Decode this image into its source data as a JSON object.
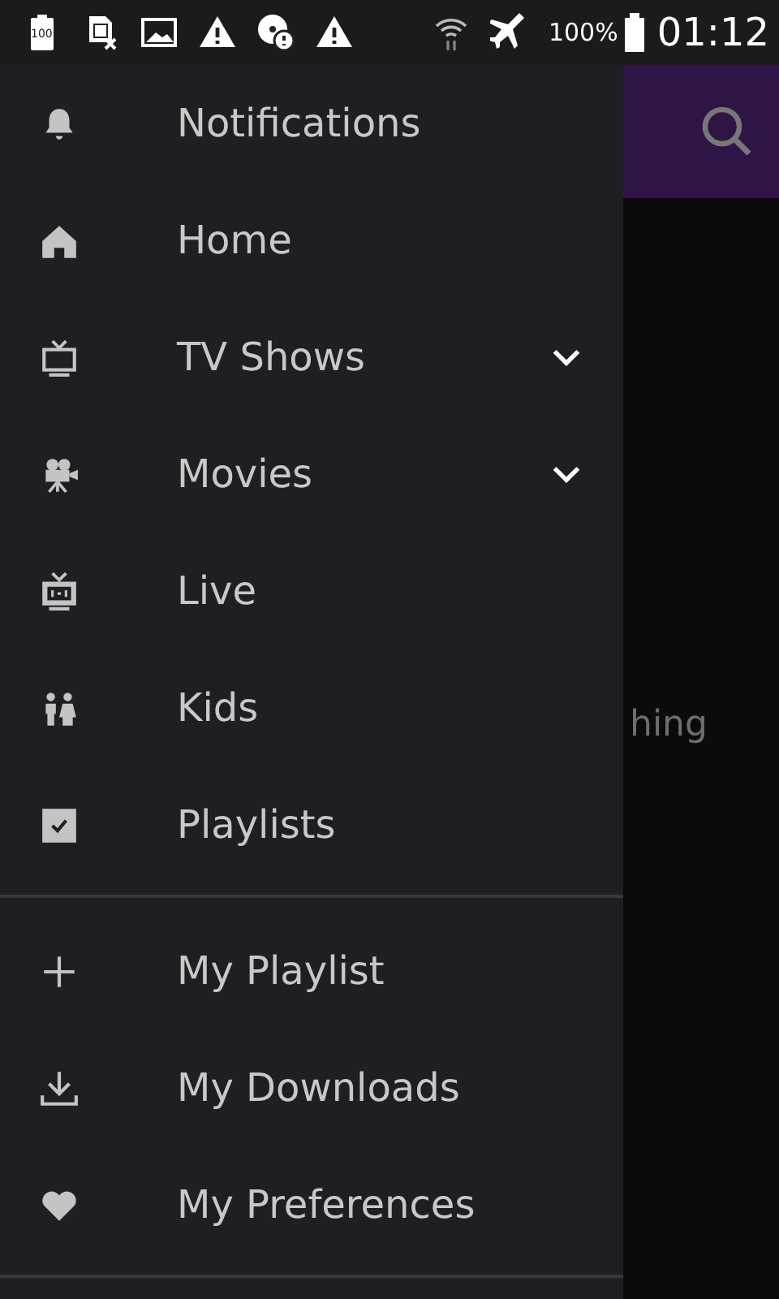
{
  "status_bar": {
    "battery_icon_label": "100",
    "battery": "100%",
    "time": "01:12"
  },
  "background": {
    "partial_text": "hing"
  },
  "drawer": {
    "sections": [
      {
        "items": [
          {
            "label": "Notifications",
            "expandable": false
          },
          {
            "label": "Home",
            "expandable": false
          },
          {
            "label": "TV Shows",
            "expandable": true
          },
          {
            "label": "Movies",
            "expandable": true
          },
          {
            "label": "Live",
            "expandable": false
          },
          {
            "label": "Kids",
            "expandable": false
          },
          {
            "label": "Playlists",
            "expandable": false
          }
        ]
      },
      {
        "items": [
          {
            "label": "My Playlist",
            "expandable": false
          },
          {
            "label": "My Downloads",
            "expandable": false
          },
          {
            "label": "My Preferences",
            "expandable": false
          }
        ]
      }
    ]
  }
}
